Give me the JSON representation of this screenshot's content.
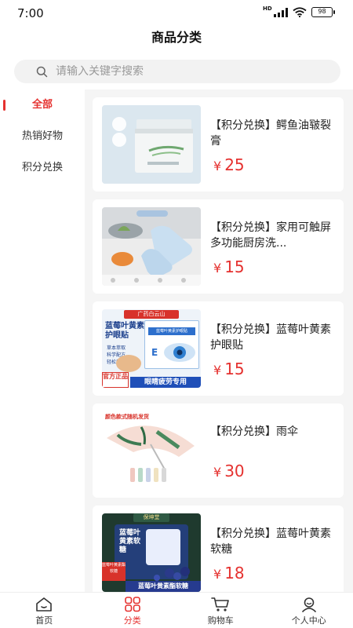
{
  "status": {
    "time": "7:00",
    "network": "HD",
    "battery": "98"
  },
  "header": {
    "title": "商品分类"
  },
  "search": {
    "placeholder": "请输入关键字搜索"
  },
  "sidebar": {
    "items": [
      {
        "label": "全部",
        "active": true
      },
      {
        "label": "热销好物",
        "active": false
      },
      {
        "label": "积分兑换",
        "active": false
      }
    ]
  },
  "products": [
    {
      "title": "【积分兑换】鳄鱼油皲裂膏",
      "currency": "¥",
      "price": "25"
    },
    {
      "title": "【积分兑换】家用可触屏多功能厨房洗...",
      "currency": "¥",
      "price": "15"
    },
    {
      "title": "【积分兑换】蓝莓叶黄素护眼贴",
      "currency": "¥",
      "price": "15"
    },
    {
      "title": "【积分兑换】雨伞",
      "currency": "¥",
      "price": "30"
    },
    {
      "title": "【积分兑换】蓝莓叶黄素软糖",
      "currency": "¥",
      "price": "18"
    }
  ],
  "product_images": {
    "p1": {
      "icon": "cream-jar-image"
    },
    "p2": {
      "icon": "gloves-image"
    },
    "p3": {
      "top_text": "广药白云山",
      "name": "蓝莓叶黄素护眼贴",
      "features": [
        "草本萃取",
        "科学配方",
        "轻松舒缓"
      ],
      "badge": "官方正品",
      "banner": "眼睛疲劳专用",
      "box_text": "蓝莓叶黄素护眼贴"
    },
    "p4": {
      "note": "颜色款式随机发货"
    },
    "p5": {
      "top_text": "保坤堂",
      "name": "蓝莓叶黄素软糖",
      "side_label": "蓝莓叶黄素酯软糖",
      "banner": "蓝莓叶黄素酯软糖"
    }
  },
  "tabbar": {
    "items": [
      {
        "label": "首页",
        "icon": "home-icon",
        "active": false
      },
      {
        "label": "分类",
        "icon": "category-icon",
        "active": true
      },
      {
        "label": "购物车",
        "icon": "cart-icon",
        "active": false
      },
      {
        "label": "个人中心",
        "icon": "profile-icon",
        "active": false
      }
    ]
  },
  "colors": {
    "accent": "#e5312f",
    "content_bg": "#f5f5f5",
    "search_bg": "#f2f2f2"
  }
}
